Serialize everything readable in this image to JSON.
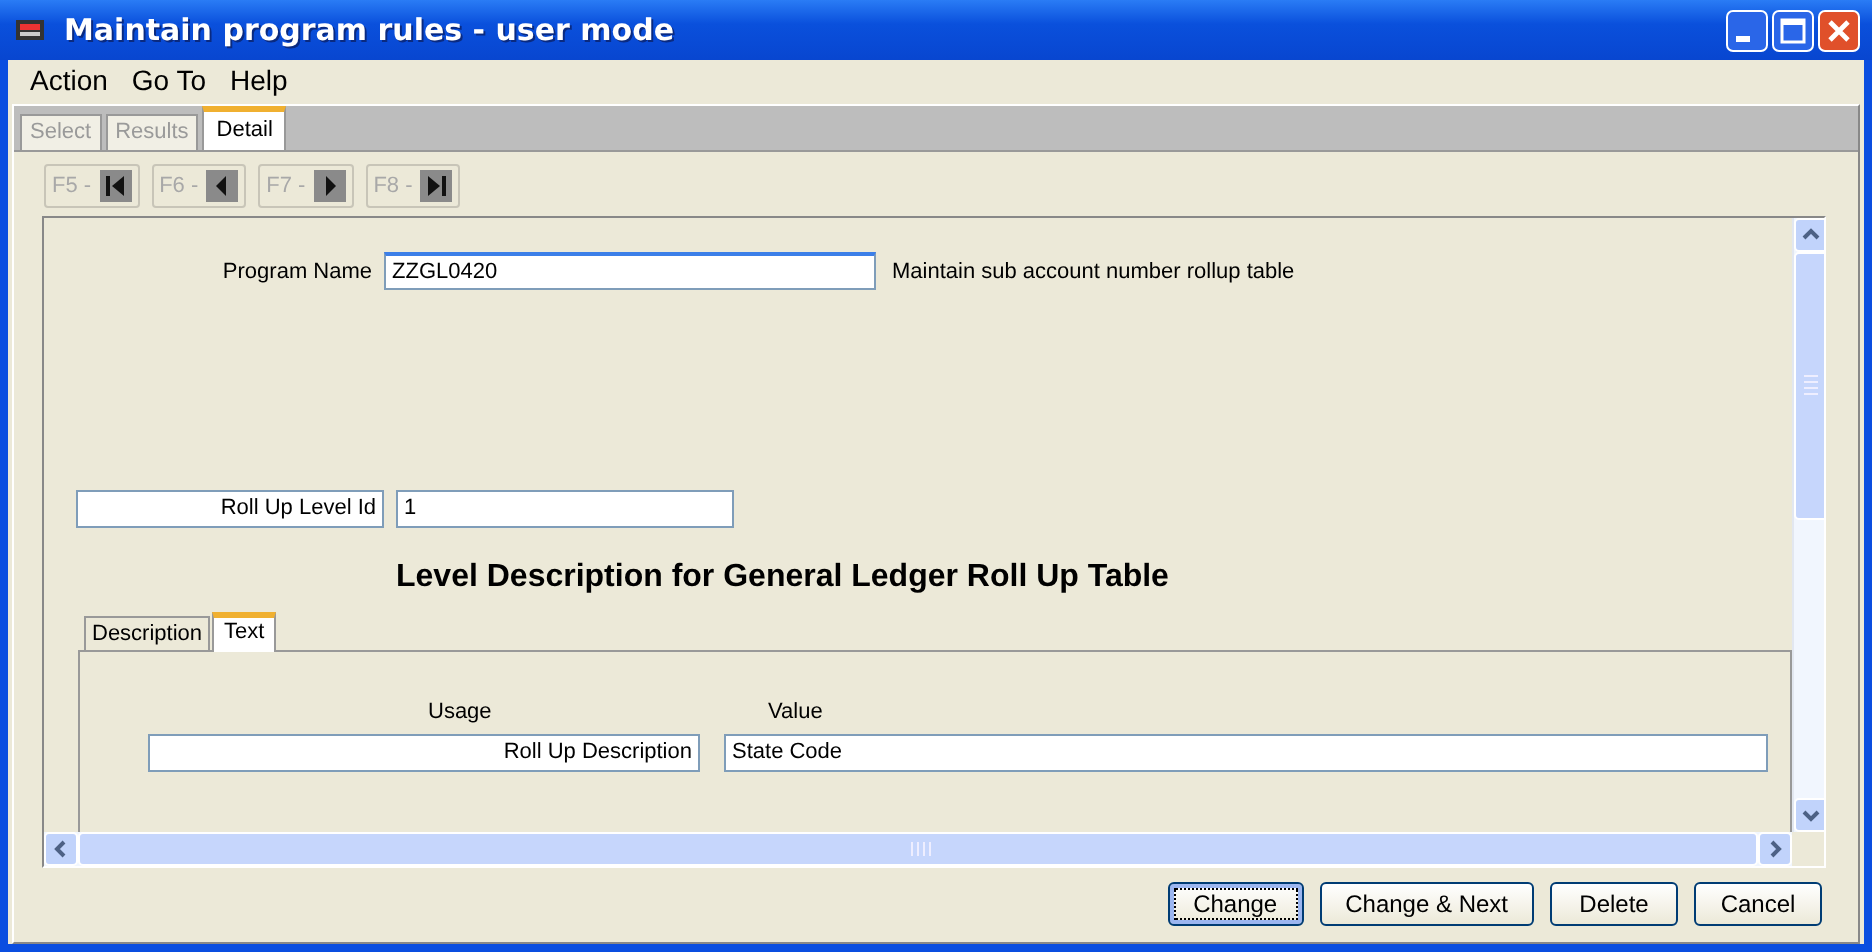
{
  "window": {
    "title": "Maintain program rules - user mode"
  },
  "menu": [
    {
      "label": "Action"
    },
    {
      "label": "Go To"
    },
    {
      "label": "Help"
    }
  ],
  "tabs": [
    {
      "label": "Select",
      "selected": false,
      "disabled": true
    },
    {
      "label": "Results",
      "selected": false,
      "disabled": true
    },
    {
      "label": "Detail",
      "selected": true,
      "disabled": false
    }
  ],
  "nav_buttons": [
    {
      "label": "F5 -",
      "kind": "first",
      "disabled": true
    },
    {
      "label": "F6 -",
      "kind": "prev",
      "disabled": true
    },
    {
      "label": "F7 -",
      "kind": "next",
      "disabled": true
    },
    {
      "label": "F8 -",
      "kind": "last",
      "disabled": true
    }
  ],
  "form": {
    "program_name": {
      "label": "Program Name",
      "value": "ZZGL0420",
      "focused": true
    },
    "program_description": "Maintain sub account number rollup table",
    "roll_up_level": {
      "label": "Roll Up Level Id",
      "value": "1"
    },
    "heading": "Level Description for General Ledger Roll Up Table",
    "inner_tabs": [
      {
        "label": "Description",
        "selected": false
      },
      {
        "label": "Text",
        "selected": true
      }
    ],
    "usage_header": "Usage",
    "value_header": "Value",
    "rows": [
      {
        "usage": "Roll Up Description",
        "value": "State Code"
      }
    ]
  },
  "buttons": [
    {
      "label": "Change",
      "focused": true
    },
    {
      "label": "Change & Next",
      "focused": false
    },
    {
      "label": "Delete",
      "focused": false
    },
    {
      "label": "Cancel",
      "focused": false
    }
  ]
}
